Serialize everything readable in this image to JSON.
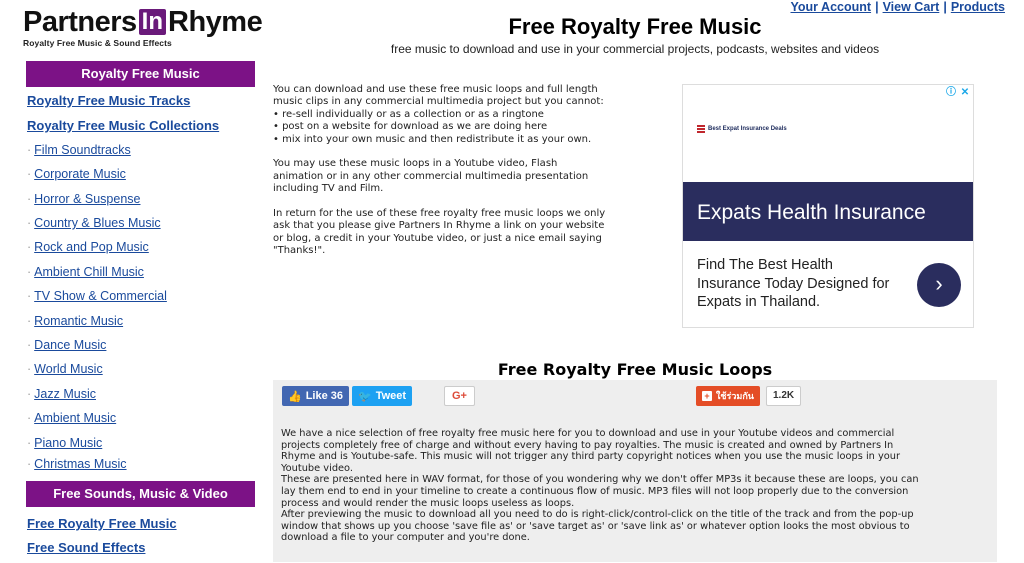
{
  "logo": {
    "part1": "Partners",
    "part2": "In",
    "part3": "Rhyme",
    "tagline": "Royalty Free Music & Sound Effects"
  },
  "toplinks": [
    "Your Account",
    "View Cart",
    "Products"
  ],
  "header": {
    "title": "Free Royalty Free Music",
    "subtitle": "free music to download and use in your commercial projects, podcasts, websites and videos"
  },
  "sidebar": {
    "heading1": "Royalty Free Music",
    "main_links": [
      "Royalty Free Music Tracks",
      "Royalty Free Music Collections"
    ],
    "sub_links": [
      "Film Soundtracks",
      "Corporate Music",
      "Horror & Suspense",
      "Country & Blues Music",
      "Rock and Pop Music",
      "Ambient Chill Music",
      "TV Show & Commercial",
      "Romantic Music",
      "Dance Music",
      "World Music",
      "Jazz Music",
      "Ambient Music",
      "Piano Music",
      "Christmas Music"
    ],
    "heading2": "Free Sounds, Music & Video",
    "main_links2": [
      "Free Royalty Free Music",
      "Free Sound Effects"
    ]
  },
  "intro": {
    "p1_lines": [
      "You can download and use these free music loops and full length",
      "music clips in any commercial multimedia project but you cannot:",
      "• re-sell individually or as a collection or as a ringtone",
      "• post on a website for download as we are doing here",
      "• mix into your own music and then redistribute it as your own."
    ],
    "p2_lines": [
      "You may use these music loops in a Youtube video, Flash",
      "animation or in any other commercial multimedia presentation",
      "including TV and Film."
    ],
    "p3_lines": [
      "In return for the use of these free royalty free music loops we only",
      "ask that you please give Partners In Rhyme a link on your website",
      "or blog, a credit in your Youtube video, or just a nice email saying",
      "\"Thanks!\"."
    ]
  },
  "ad": {
    "brand": "Best Expat Insurance Deals",
    "headline": "Expats Health Insurance",
    "body": "Find The Best Health Insurance Today Designed for Expats in Thailand.",
    "arrow": "›",
    "info_icon": "ⓘ",
    "close_icon": "✕"
  },
  "loops": {
    "title": "Free Royalty Free Music Loops",
    "like_label": "Like 36",
    "tweet_label": "Tweet",
    "gplus_label": "G+",
    "share_label": "ใช้ร่วมกัน",
    "share_count": "1.2K",
    "body_lines": [
      "We have a nice selection of free royalty free music here for you to download and use in your Youtube videos and commercial",
      "projects completely free of charge and without every having to pay royalties. The music is created and owned by Partners In",
      "Rhyme and is Youtube-safe. This music will not trigger any third party copyright notices when you use the music loops in your",
      "Youtube video.",
      "These are presented here in WAV format, for those of you wondering why we don't offer MP3s it because these are loops, you can",
      "lay them end to end in your timeline to create a continuous flow of music. MP3 files will not loop properly due to the conversion",
      "process and would render the music loops useless as loops.",
      "After previewing the music to download all you need to do is right-click/control-click on the title of the track and from the pop-up",
      "window that shows up you choose 'save file as' or 'save target as' or 'save link as' or whatever option looks the most obvious to",
      "download a file to your computer and you're done."
    ]
  }
}
